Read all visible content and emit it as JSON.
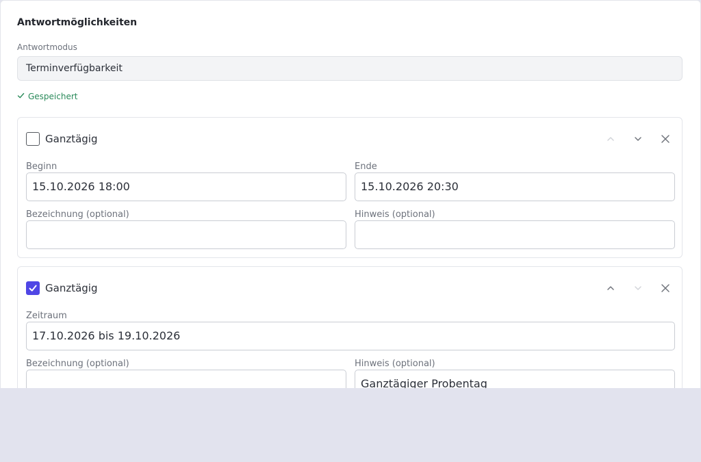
{
  "section": {
    "title": "Antwortmöglichkeiten"
  },
  "mode": {
    "label": "Antwortmodus",
    "value": "Terminverfügbarkeit"
  },
  "status": {
    "saved": "Gespeichert"
  },
  "options": [
    {
      "all_day_label": "Ganztägig",
      "all_day_checked": false,
      "start_label": "Beginn",
      "start_value": "15.10.2026 18:00",
      "end_label": "Ende",
      "end_value": "15.10.2026 20:30",
      "name_label": "Bezeichnung (optional)",
      "name_value": "",
      "note_label": "Hinweis (optional)",
      "note_value": ""
    },
    {
      "all_day_label": "Ganztägig",
      "all_day_checked": true,
      "range_label": "Zeitraum",
      "range_value": "17.10.2026 bis 19.10.2026",
      "name_label": "Bezeichnung (optional)",
      "name_value": "",
      "note_label": "Hinweis (optional)",
      "note_value": "Ganztägiger Probentag"
    }
  ],
  "icons": {
    "up": "chevron-up-icon",
    "down": "chevron-down-icon",
    "remove": "close-icon",
    "saved": "check-icon"
  },
  "colors": {
    "accent": "#4f46e5",
    "success": "#2a8a5a",
    "background": "#e2e3ee"
  }
}
